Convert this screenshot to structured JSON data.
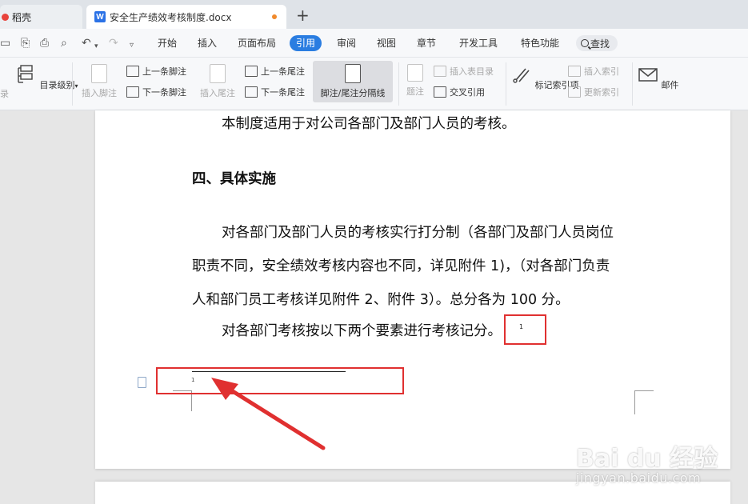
{
  "tabs": {
    "home_label": "稻壳",
    "doc_title": "安全生产绩效考核制度.docx",
    "new_tab": "+"
  },
  "menu": {
    "items": [
      "开始",
      "插入",
      "页面布局",
      "引用",
      "审阅",
      "视图",
      "章节",
      "开发工具",
      "特色功能"
    ],
    "active": "引用",
    "search_label": "查找"
  },
  "ribbon": {
    "toc_partial": "录",
    "toc_level": "目录级别",
    "insert_footnote": "插入脚注",
    "prev_footnote": "上一条脚注",
    "next_footnote": "下一条脚注",
    "insert_endnote": "插入尾注",
    "prev_endnote": "上一条尾注",
    "next_endnote": "下一条尾注",
    "separator": "脚注/尾注分隔线",
    "caption": "题注",
    "insert_table_toc": "插入表目录",
    "cross_ref": "交叉引用",
    "mark_index": "标记索引项",
    "insert_index": "插入索引",
    "update_index": "更新索引",
    "mail": "邮件"
  },
  "document": {
    "line1": "本制度适用于对公司各部门及部门人员的考核。",
    "heading": "四、具体实施",
    "para1_l1": "对各部门及部门人员的考核实行打分制（各部门及部门人员岗位",
    "para1_l2": "职责不同，安全绩效考核内容也不同，详见附件 1)，（对各部门负责",
    "para1_l3": "人和部门员工考核详见附件 2、附件 3）。总分各为 100 分。",
    "para2": "对各部门考核按以下两个要素进行考核记分。",
    "footnote_ref": "1",
    "footnote_num": "1"
  },
  "watermark": {
    "logo": "Bai du 经验",
    "url": "jingyan.baidu.com"
  },
  "colors": {
    "accent": "#2a7de1",
    "annotation_red": "#e03030"
  }
}
